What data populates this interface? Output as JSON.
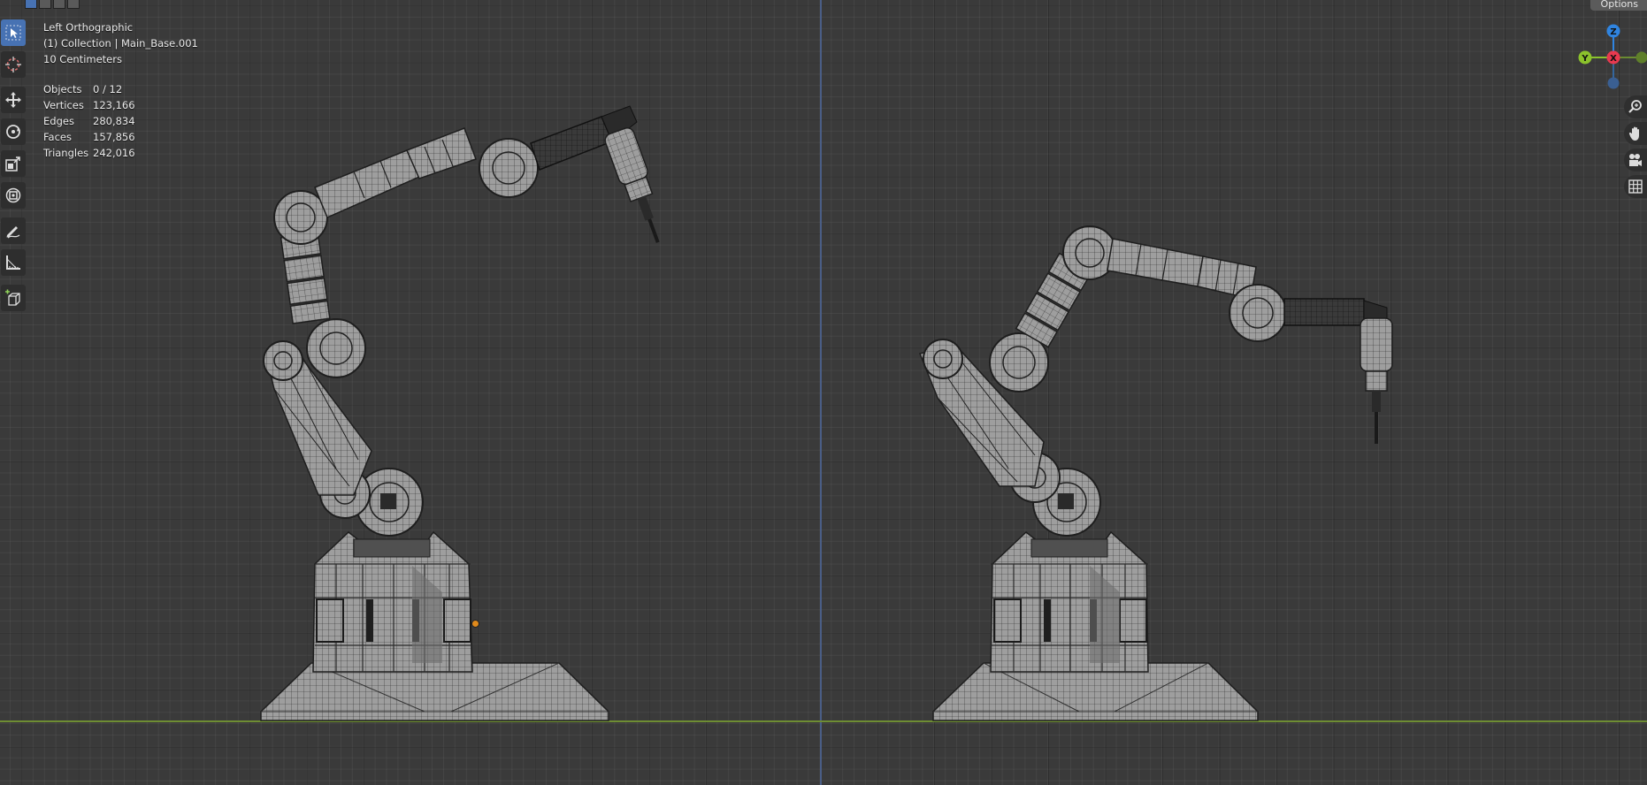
{
  "header": {
    "options_label": "Options",
    "mode_buttons": [
      "select-box-icon",
      "select-mode-icon",
      "select-mode-icon",
      "select-mode-icon"
    ]
  },
  "toolbar": {
    "tools": [
      {
        "name": "select-cursor-icon",
        "active": true
      },
      {
        "name": "cursor-3d-icon",
        "active": false
      },
      {
        "name": "move-icon",
        "active": false
      },
      {
        "name": "rotate-icon",
        "active": false
      },
      {
        "name": "scale-icon",
        "active": false
      },
      {
        "name": "transform-icon",
        "active": false
      },
      {
        "name": "annotate-icon",
        "active": false
      },
      {
        "name": "measure-icon",
        "active": false
      },
      {
        "name": "add-cube-icon",
        "active": false
      }
    ]
  },
  "overlay": {
    "view_name": "Left Orthographic",
    "collection": "(1) Collection | Main_Base.001",
    "grid_scale": "10 Centimeters",
    "stats": [
      {
        "label": "Objects",
        "value": "0 / 12"
      },
      {
        "label": "Vertices",
        "value": "123,166"
      },
      {
        "label": "Edges",
        "value": "280,834"
      },
      {
        "label": "Faces",
        "value": "157,856"
      },
      {
        "label": "Triangles",
        "value": "242,016"
      }
    ]
  },
  "gizmo": {
    "z_label": "Z",
    "y_label": "Y",
    "x_label": "X",
    "colors": {
      "x": "#e8394f",
      "y": "#8bc22c",
      "z": "#2f84e0"
    }
  },
  "nav": {
    "buttons": [
      "zoom-icon",
      "pan-hand-icon",
      "camera-icon",
      "grid-view-icon"
    ]
  },
  "colors": {
    "background": "#3a3a3a",
    "axis_x_line": "#6e8d33",
    "axis_z_line": "#4a5e86",
    "active_tool": "#4772b3",
    "mesh_face": "#9c9c9c",
    "mesh_wire": "#1e1e1e",
    "origin": "#e08a1c"
  }
}
